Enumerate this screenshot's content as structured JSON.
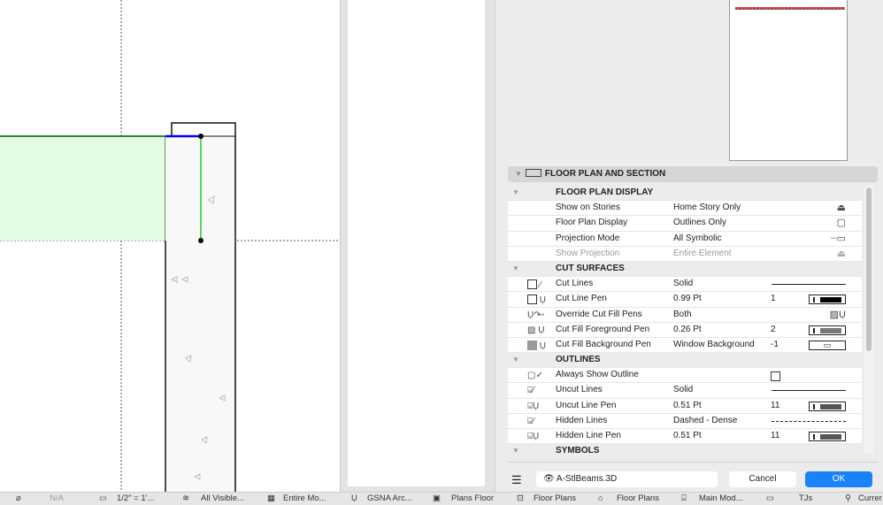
{
  "section": {
    "title": "FLOOR PLAN AND SECTION"
  },
  "rows": [
    {
      "type": "group",
      "name": "FLOOR PLAN DISPLAY"
    },
    {
      "name": "Show on Stories",
      "value": "Home Story Only",
      "icon_right": "stories-icon"
    },
    {
      "name": "Floor Plan Display",
      "value": "Outlines Only",
      "icon_right": "cube-icon"
    },
    {
      "name": "Projection Mode",
      "value": "All Symbolic",
      "icon_right": "projection-icon"
    },
    {
      "name": "Show Projection",
      "value": "Entire Element",
      "disabled": true,
      "icon_right": "show-projection-icon"
    },
    {
      "type": "group",
      "name": "CUT SURFACES"
    },
    {
      "name": "Cut Lines",
      "value": "Solid"
    },
    {
      "name": "Cut Line Pen",
      "value": "0.99 Pt",
      "num": "1",
      "pen_color": "#000000"
    },
    {
      "name": "Override Cut Fill Pens",
      "value": "Both"
    },
    {
      "name": "Cut Fill Foreground Pen",
      "value": "0.26 Pt",
      "num": "2",
      "pen_color": "#777777"
    },
    {
      "name": "Cut Fill Background Pen",
      "value": "Window Background",
      "num": "-1"
    },
    {
      "type": "group",
      "name": "OUTLINES"
    },
    {
      "name": "Always Show Outline",
      "value": "",
      "checked": false
    },
    {
      "name": "Uncut Lines",
      "value": "Solid"
    },
    {
      "name": "Uncut Line Pen",
      "value": "0.51 Pt",
      "num": "11",
      "pen_color": "#555555"
    },
    {
      "name": "Hidden Lines",
      "value": "Dashed - Dense"
    },
    {
      "name": "Hidden Line Pen",
      "value": "0.51 Pt",
      "num": "11",
      "pen_color": "#555555"
    },
    {
      "type": "group",
      "name": "SYMBOLS"
    }
  ],
  "footer": {
    "layer": "A-StlBeams.3D",
    "cancel": "Cancel",
    "ok": "OK"
  },
  "status": [
    "N/A",
    "1/2\"  =  1'...",
    "All Visible...",
    "Entire Mo...",
    "GSNA Arc...",
    "Plans Floor",
    "Floor Plans",
    "Floor Plans",
    "Main Mod...",
    "TJs",
    "Currer"
  ],
  "colors": {
    "accent": "#1a82fb",
    "fill": "#e3fbe3",
    "selection": "#0000ff",
    "edge": "#22bb22"
  }
}
